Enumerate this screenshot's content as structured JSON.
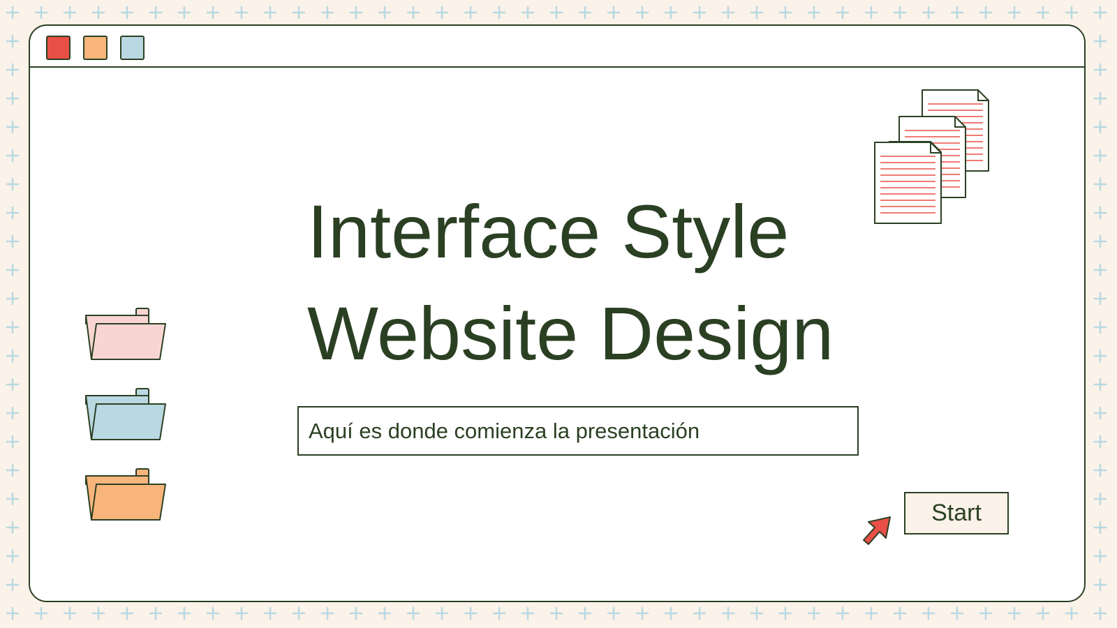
{
  "slide": {
    "title_line1": "Interface Style",
    "title_line2": "Website Design",
    "subtitle": "Aquí es donde comienza la presentación",
    "start_label": "Start"
  },
  "window": {
    "controls": [
      {
        "name": "red",
        "color": "#e84f46"
      },
      {
        "name": "orange",
        "color": "#f8b57b"
      },
      {
        "name": "blue",
        "color": "#b9d8e2"
      }
    ]
  },
  "icons": {
    "folders": [
      "folder-icon-pink",
      "folder-icon-blue",
      "folder-icon-orange"
    ],
    "documents": "document-stack-icon",
    "cursor": "arrow-cursor-icon"
  },
  "colors": {
    "background": "#fbf2e9",
    "plus_pattern": "#b9d8e2",
    "ink": "#2b4023",
    "red": "#e84f46",
    "orange": "#f8b57b",
    "blue": "#b9d8e2",
    "pink": "#f8d5d3"
  }
}
